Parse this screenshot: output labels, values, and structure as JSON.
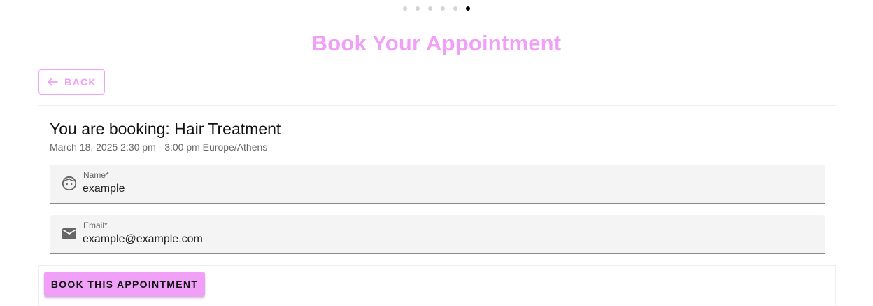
{
  "stepper": {
    "total_steps": 6,
    "active_step": 6
  },
  "page": {
    "title": "Book Your Appointment"
  },
  "back_button": {
    "label": "BACK",
    "icon": "arrow-left-icon"
  },
  "booking": {
    "title": "You are booking: Hair Treatment",
    "time": "March 18, 2025 2:30 pm - 3:00 pm Europe/Athens"
  },
  "form": {
    "name": {
      "label": "Name*",
      "value": "example",
      "icon": "face-icon"
    },
    "email": {
      "label": "Email*",
      "value": "example@example.com",
      "icon": "mail-icon"
    }
  },
  "submit_button": {
    "label": "BOOK THIS APPOINTMENT"
  },
  "colors": {
    "accent": "#f0a0f6",
    "field_bg": "#f4f4f4"
  }
}
